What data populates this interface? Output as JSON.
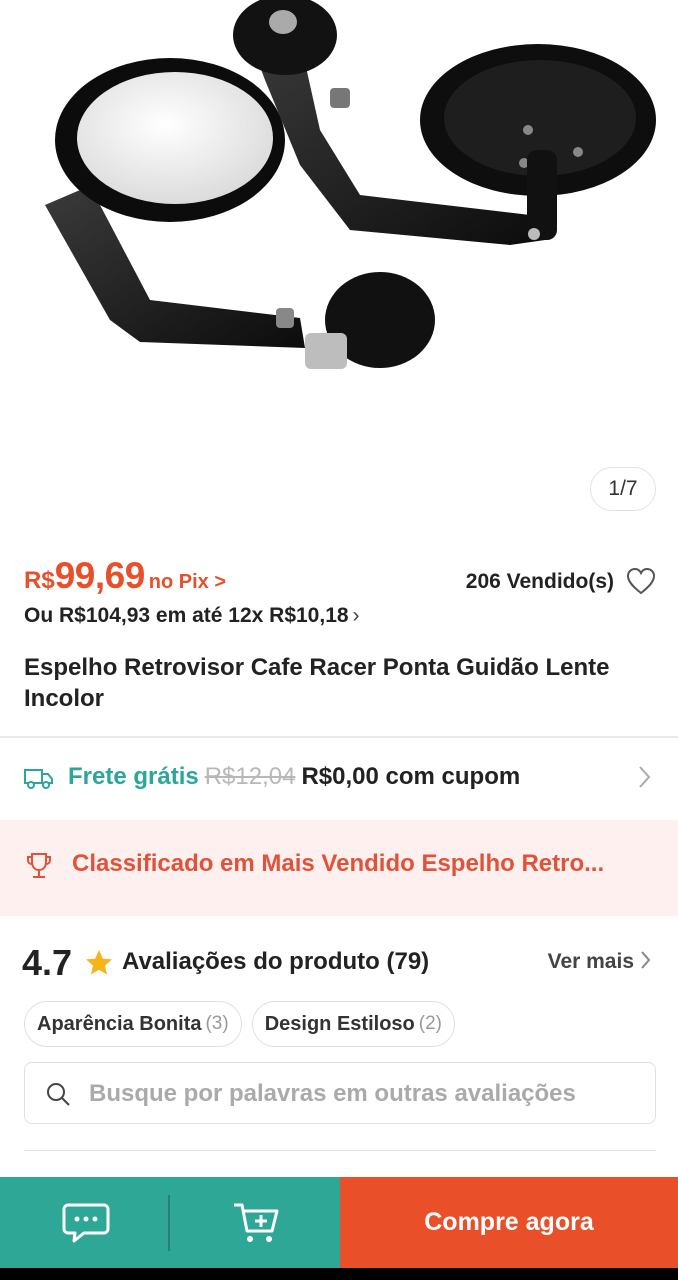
{
  "gallery": {
    "counter": "1/7",
    "image_alt": "Espelho Retrovisor Cafe Racer Ponta Guidão Lente Incolor"
  },
  "price": {
    "currency": "R$",
    "value": "99,69",
    "pix_label": "no Pix >",
    "sold": "206 Vendido(s)",
    "installments": "Ou R$104,93 em até 12x R$10,18",
    "installments_chevron": "›"
  },
  "product": {
    "title": "Espelho Retrovisor Cafe Racer Ponta Guidão Lente Incolor"
  },
  "shipping": {
    "free_label": "Frete grátis",
    "old_price": "R$12,04",
    "new_price": "R$0,00 com cupom"
  },
  "ranking": {
    "text": "Classificado em Mais Vendido Espelho Retro..."
  },
  "reviews": {
    "rating": "4.7",
    "title": "Avaliações do produto (79)",
    "see_more": "Ver mais",
    "tags": [
      {
        "label": "Aparência Bonita",
        "count": "(3)"
      },
      {
        "label": "Design Estiloso",
        "count": "(2)"
      }
    ],
    "search_placeholder": "Busque por palavras em outras avaliações"
  },
  "bottom_bar": {
    "buy_label": "Compre agora",
    "chat_icon": "chat-icon",
    "cart_icon": "add-to-cart-icon"
  },
  "colors": {
    "brand_orange": "#e9502a",
    "teal": "#2ea797",
    "price_red": "#e7502a",
    "ranking_bg": "#fdf0ee"
  }
}
